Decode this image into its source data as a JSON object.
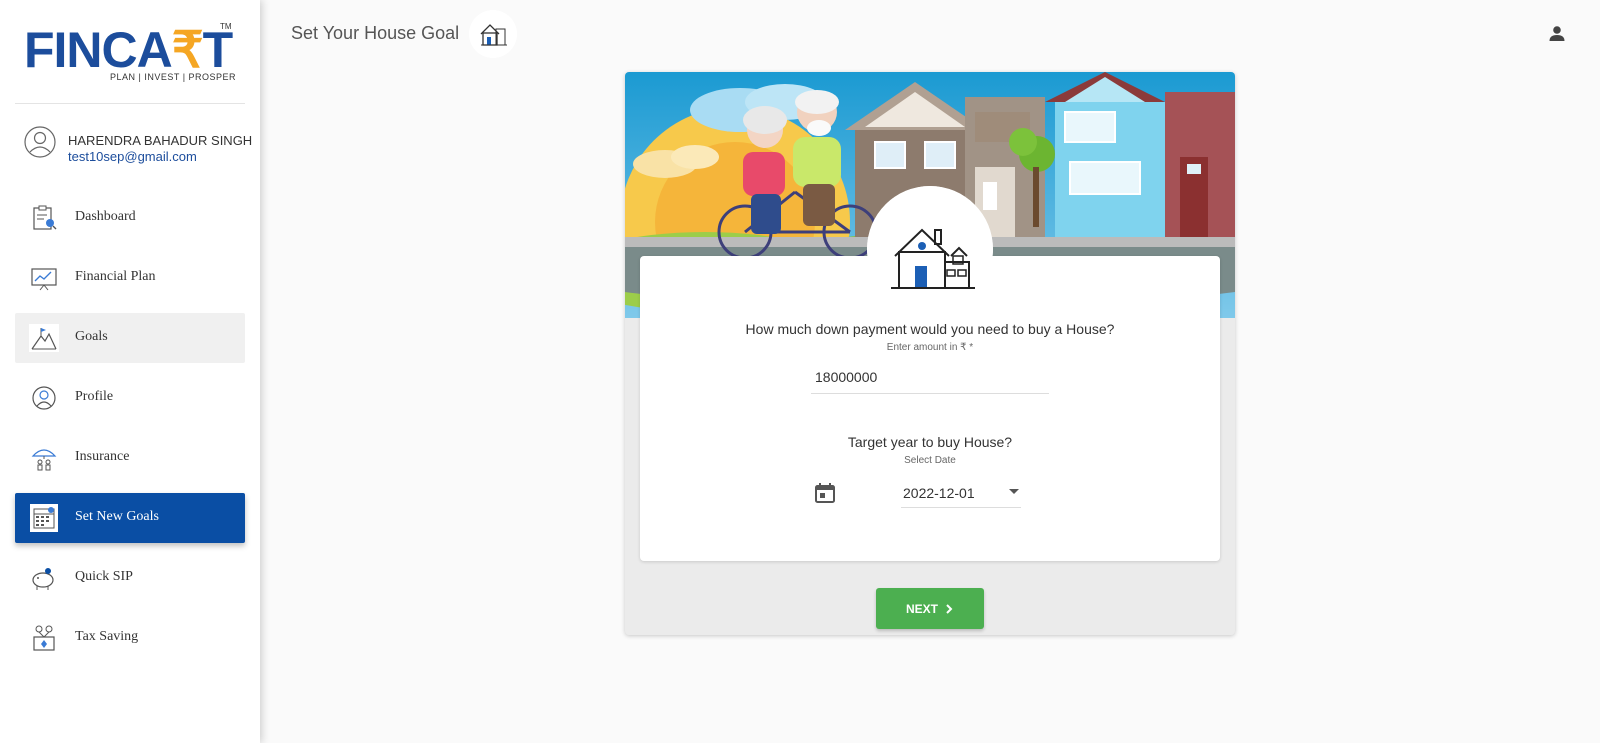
{
  "brand": {
    "logo_text_a": "FINCA",
    "logo_text_r": "₹",
    "logo_text_b": "T",
    "tm": "TM",
    "tagline": "PLAN | INVEST | PROSPER"
  },
  "user": {
    "name": "HARENDRA BAHADUR SINGH",
    "email": "test10sep@gmail.com"
  },
  "nav": [
    {
      "label": "Dashboard",
      "icon": "dashboard-icon"
    },
    {
      "label": "Financial Plan",
      "icon": "financial-plan-icon"
    },
    {
      "label": "Goals",
      "icon": "goals-icon"
    },
    {
      "label": "Profile",
      "icon": "profile-icon"
    },
    {
      "label": "Insurance",
      "icon": "insurance-icon"
    },
    {
      "label": "Set New Goals",
      "icon": "set-new-goals-icon"
    },
    {
      "label": "Quick SIP",
      "icon": "quick-sip-icon"
    },
    {
      "label": "Tax Saving",
      "icon": "tax-saving-icon"
    }
  ],
  "header": {
    "title": "Set Your House Goal"
  },
  "form": {
    "question_amount": "How much down payment would you need to buy a House?",
    "amount_hint": "Enter amount in ₹ *",
    "amount_value": "18000000",
    "question_year": "Target year to buy House?",
    "year_hint": "Select Date",
    "year_value": "2022-12-01",
    "next_label": "NEXT"
  },
  "colors": {
    "brand_blue": "#1c4d9c",
    "active_nav": "#0a4ea4",
    "next_green": "#4caf50",
    "rupee_orange": "#f5a623"
  }
}
